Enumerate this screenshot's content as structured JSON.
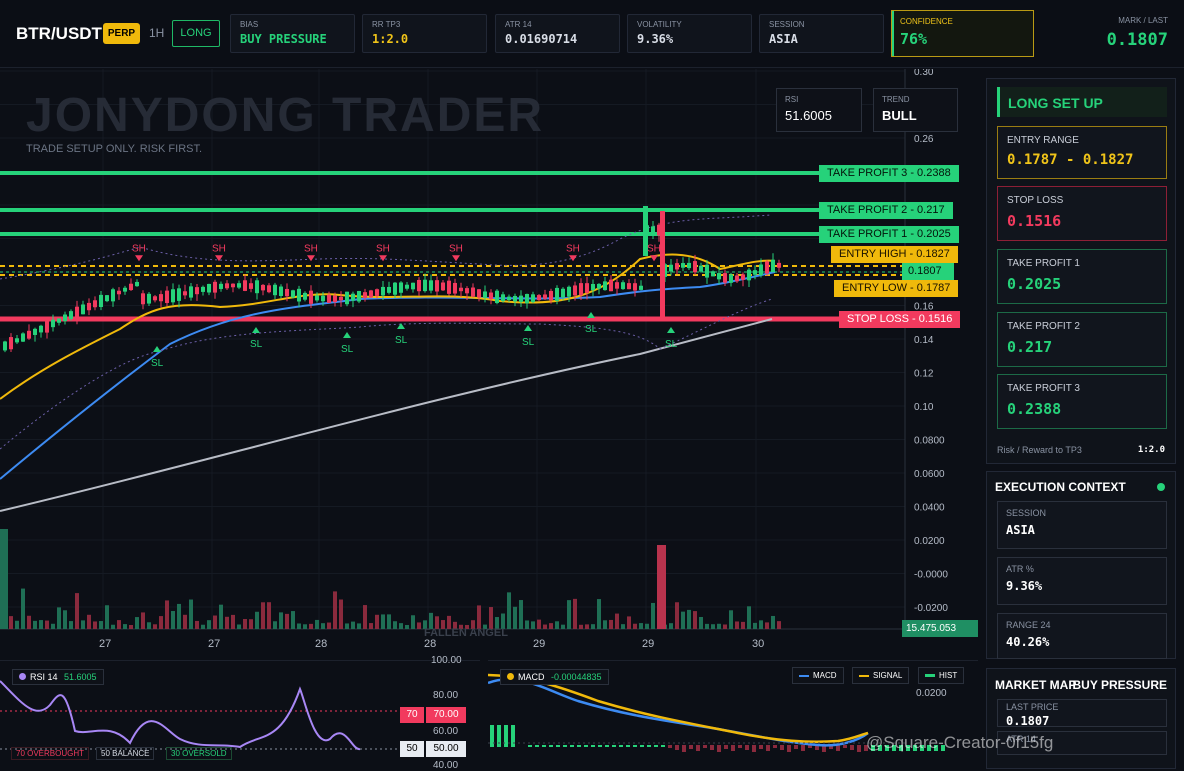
{
  "header": {
    "symbol": "BTR/USDT",
    "perp_badge": "PERP",
    "timeframe": "1H",
    "side_badge": "LONG",
    "stats": [
      {
        "label": "BIAS",
        "value": "BUY PRESSURE",
        "color": "#26d27a"
      },
      {
        "label": "RR TP3",
        "value": "1:2.0",
        "color": "#f0c419"
      },
      {
        "label": "ATR 14",
        "value": "0.01690714",
        "color": "#ffffff"
      },
      {
        "label": "VOLATILITY",
        "value": "9.36%",
        "color": "#ffffff"
      },
      {
        "label": "SESSION",
        "value": "ASIA",
        "color": "#ffffff"
      }
    ],
    "confidence_label": "CONFIDENCE",
    "confidence_value": "76%",
    "mark_label": "MARK / LAST",
    "mark_value": "0.1807"
  },
  "chart": {
    "watermark": "JONYDONG TRADER",
    "subtitle": "TRADE SETUP ONLY. RISK FIRST.",
    "rsi_box": {
      "label": "RSI",
      "value": "51.6005"
    },
    "trend_box": {
      "label": "TREND",
      "value": "BULL"
    },
    "levels": {
      "tp3": "TAKE PROFIT 3 - 0.2388",
      "tp2": "TAKE PROFIT 2 - 0.217",
      "tp1": "TAKE PROFIT 1 - 0.2025",
      "entry_high": "ENTRY HIGH - 0.1827",
      "last": "0.1807",
      "entry_low": "ENTRY LOW - 0.1787",
      "stop": "STOP LOSS - 0.1516"
    },
    "markers": {
      "sh": "SH",
      "sl": "SL"
    },
    "y_ticks": [
      "0.30",
      "0.28",
      "0.26",
      "0.24",
      "0.22",
      "0.20",
      "0.18",
      "0.16",
      "0.14",
      "0.12",
      "0.10",
      "0.0800",
      "0.0600",
      "0.0400",
      "0.0200",
      "-0.0000",
      "-0.0200"
    ],
    "x_ticks": [
      "27",
      "27",
      "28",
      "28",
      "29",
      "29",
      "30"
    ],
    "volume_label": "15.475.053",
    "fallen_label": "FALLEN ANGEL",
    "colors": {
      "up": "#26d27a",
      "down": "#f23a5e",
      "ema_fast": "#f0b90b",
      "ema_mid": "#3d8bf2",
      "ema_slow": "#b8bcc6",
      "accent": "#f0c419"
    }
  },
  "rsi_panel": {
    "title": "RSI 14",
    "value": "51.6005",
    "overbought": "70 OVERBOUGHT",
    "balance": "50 BALANCE",
    "oversold": "30 OVERSOLD",
    "ticks": [
      "100.00",
      "80.00",
      "60.00",
      "40.00"
    ],
    "tag70a": "70",
    "tag70b": "70.00",
    "tag50a": "50",
    "tag50b": "50.00"
  },
  "macd_panel": {
    "title": "MACD",
    "value": "-0.00044835",
    "legend": [
      "MACD",
      "SIGNAL",
      "HIST"
    ],
    "tick": "0.0200",
    "watermark": "@Square-Creator-0f15fg"
  },
  "sidebar": {
    "title": "LONG SET UP",
    "cards": [
      {
        "label": "ENTRY RANGE",
        "value": "0.1787 - 0.1827",
        "color": "#f0c419"
      },
      {
        "label": "STOP LOSS",
        "value": "0.1516",
        "color": "#f23a5e"
      },
      {
        "label": "TAKE PROFIT 1",
        "value": "0.2025",
        "color": "#26d27a"
      },
      {
        "label": "TAKE PROFIT 2",
        "value": "0.217",
        "color": "#26d27a"
      },
      {
        "label": "TAKE PROFIT 3",
        "value": "0.2388",
        "color": "#26d27a"
      }
    ],
    "rr_label": "Risk / Reward to TP3",
    "rr_value": "1:2.0",
    "exec_title": "EXECUTION CONTEXT",
    "exec_items": [
      {
        "label": "SESSION",
        "value": "ASIA"
      },
      {
        "label": "ATR %",
        "value": "9.36%"
      },
      {
        "label": "RANGE 24",
        "value": "40.26%"
      }
    ],
    "market_title": "MARKET MAP",
    "market_value": "BUY PRESSURE",
    "market_items": [
      {
        "label": "LAST PRICE",
        "value": "0.1807"
      },
      {
        "label": "ATR 14",
        "value": ""
      }
    ]
  }
}
